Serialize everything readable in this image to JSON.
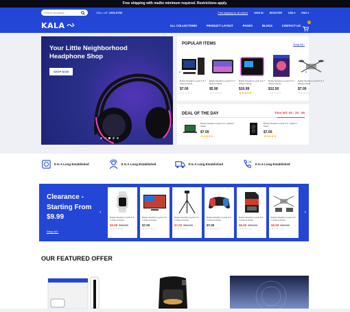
{
  "topbar": {
    "text": "Free shipping with mailto minimum required. Restrictions apply."
  },
  "header": {
    "search_placeholder": "Search products ...",
    "call_label": "CALL US:",
    "call_number": "1900-5789",
    "links": [
      "Free shipping for all orders!",
      "SIGN IN",
      "REGISTER",
      "USD ▾",
      "ENG ▾"
    ],
    "logo": "KALA",
    "nav": [
      "ALL COLLECTIONS",
      "PRODUCT LAYOUT",
      "PAGES",
      "BLOGS",
      "CONTACT US"
    ],
    "cart_count": "0"
  },
  "hero": {
    "title": "Your Little Neighborhood Headphone Shop",
    "button": "SHOP NOW"
  },
  "popular": {
    "title": "POPULAR ITEMS",
    "shop_all": "Shop All ›",
    "items": [
      {
        "name": "Buddy Readers Levels 5 & 7 (Parent Pack)",
        "price": "$7.00",
        "rated": false
      },
      {
        "name": "Buddy Readers Levels 5 & 7 (Parent Pack)",
        "price": "$5.90",
        "rated": false
      },
      {
        "name": "Buddy Readers Levels 5 & 7 (Parent Pack)",
        "price": "$10.99",
        "rated": true
      },
      {
        "name": "Buddy Readers Levels 5 & 7 (Parent Pack)",
        "price": "$12.50",
        "rated": false
      },
      {
        "name": "Buddy Readers Levels 5 & 7 (Parent Pack)",
        "price": "$7.00",
        "rated": false
      }
    ]
  },
  "deal": {
    "title": "DEAL OF THE DAY",
    "timer": "Time left: 00 : 20 : 55",
    "items": [
      {
        "name": "Buddy Readers Levels 5 & 7 (Parent Pack)",
        "price": "$7.00"
      },
      {
        "name": "Buddy Readers Levels 5 & 7 (Parent Pack)",
        "price": "$7.00"
      }
    ]
  },
  "features": [
    "It Is A Long Established",
    "It Is A Long Established",
    "It Is A Long Established",
    "It Is A Long Established"
  ],
  "clearance": {
    "title": "Clearance - Starting From $9.99",
    "link": "Shop All ›",
    "items": [
      {
        "name": "Buddy Readers Levels 5 & 7 (Parent Pack)",
        "price": "$6.99",
        "old": "$15.99"
      },
      {
        "name": "Buddy Readers Levels 5 & 7 (Parent Pack)",
        "price": "$7.00",
        "old": ""
      },
      {
        "name": "Buddy Readers Levels 5 & 7 (Parent Pack)",
        "price": "$7.00",
        "old": "$15.99"
      },
      {
        "name": "Buddy Readers Levels 5 & 7 (Parent Pack)",
        "price": "$7.00",
        "old": ""
      },
      {
        "name": "Buddy Readers Levels 5 & 7 (Parent Pack)",
        "price": "$6.99",
        "old": "$15.99"
      },
      {
        "name": "Buddy Readers Levels 5 & 7 (Parent Pack)",
        "price": "$6.99",
        "old": "$15.99"
      }
    ]
  },
  "featured": {
    "title": "OUR FEATURED OFFER"
  },
  "colors": {
    "brand": "#2346d6",
    "accent": "#f5b400",
    "sale": "#e53b3b"
  }
}
